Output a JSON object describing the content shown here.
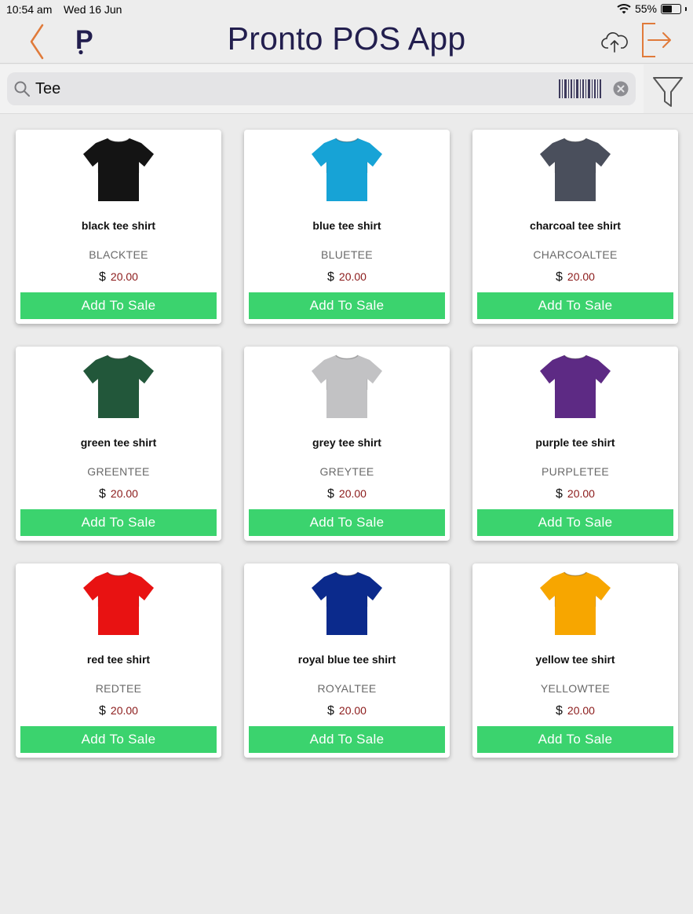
{
  "status_bar": {
    "time": "10:54 am",
    "date": "Wed 16 Jun",
    "battery": "55%",
    "battery_level": 0.55
  },
  "header": {
    "title": "Pronto POS App",
    "logo_letter": "P",
    "icons": {
      "back": "chevron-left-icon",
      "sync": "cloud-upload-icon",
      "logout": "logout-icon"
    },
    "accent_color": "#e07a3a",
    "title_color": "#221e4e"
  },
  "search": {
    "value": "Tee",
    "placeholder": ""
  },
  "button_color": "#3bd36e",
  "products": [
    {
      "name": "black tee shirt",
      "code": "BLACKTEE",
      "currency": "$",
      "price": "20.00",
      "button": "Add To Sale",
      "color": "#141414"
    },
    {
      "name": "blue tee shirt",
      "code": "BLUETEE",
      "currency": "$",
      "price": "20.00",
      "button": "Add To Sale",
      "color": "#17a3d6"
    },
    {
      "name": "charcoal tee shirt",
      "code": "CHARCOALTEE",
      "currency": "$",
      "price": "20.00",
      "button": "Add To Sale",
      "color": "#4a4f5c"
    },
    {
      "name": "green tee shirt",
      "code": "GREENTEE",
      "currency": "$",
      "price": "20.00",
      "button": "Add To Sale",
      "color": "#22573a"
    },
    {
      "name": "grey tee shirt",
      "code": "GREYTEE",
      "currency": "$",
      "price": "20.00",
      "button": "Add To Sale",
      "color": "#c2c2c4"
    },
    {
      "name": "purple tee shirt",
      "code": "PURPLETEE",
      "currency": "$",
      "price": "20.00",
      "button": "Add To Sale",
      "color": "#5d2a84"
    },
    {
      "name": "red tee shirt",
      "code": "REDTEE",
      "currency": "$",
      "price": "20.00",
      "button": "Add To Sale",
      "color": "#e81212"
    },
    {
      "name": "royal blue tee shirt",
      "code": "ROYALTEE",
      "currency": "$",
      "price": "20.00",
      "button": "Add To Sale",
      "color": "#0b2a8c"
    },
    {
      "name": "yellow tee shirt",
      "code": "YELLOWTEE",
      "currency": "$",
      "price": "20.00",
      "button": "Add To Sale",
      "color": "#f7a600"
    }
  ]
}
